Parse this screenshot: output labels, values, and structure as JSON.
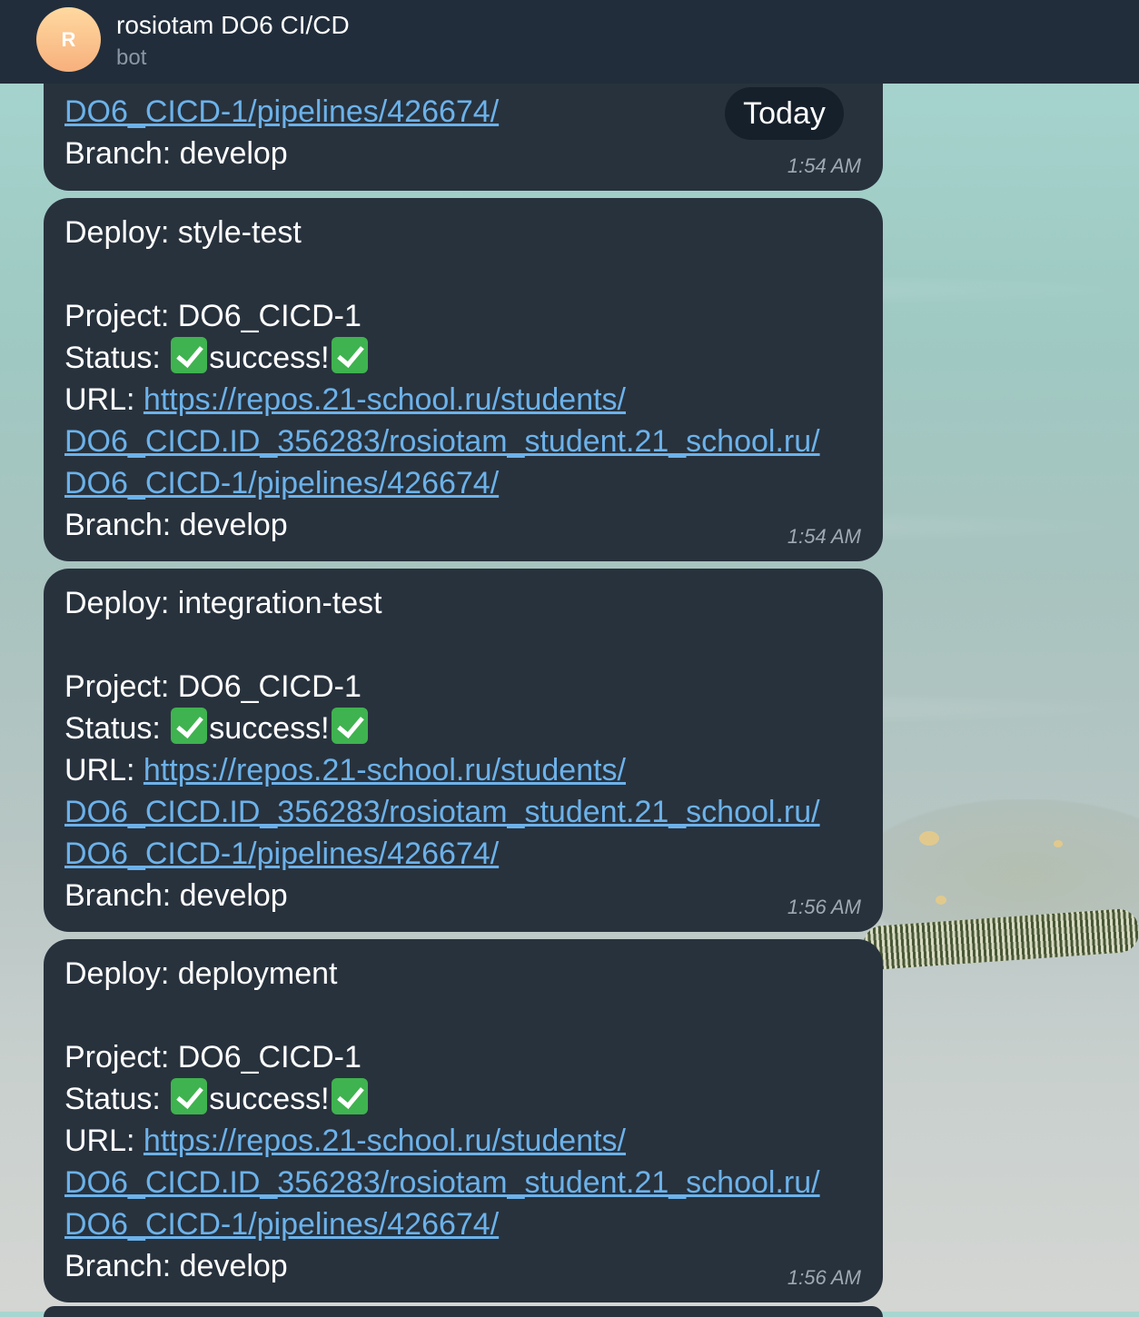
{
  "header": {
    "avatar_letter": "R",
    "title": "rosiotam DO6 CI/CD",
    "subtitle": "bot"
  },
  "date_badge": "Today",
  "messages": [
    {
      "partial": true,
      "url_line3": "DO6_CICD-1/pipelines/426674/",
      "branch": "Branch: develop",
      "time": "1:54 AM"
    },
    {
      "deploy": "Deploy: style-test",
      "project": "Project: DO6_CICD-1",
      "status_prefix": "Status: ",
      "status_text": "success!",
      "url_prefix": "URL: ",
      "url_line1": "https://repos.21-school.ru/students/",
      "url_line2": "DO6_CICD.ID_356283/rosiotam_student.21_school.ru/",
      "url_line3": "DO6_CICD-1/pipelines/426674/",
      "branch": "Branch: develop",
      "time": "1:54 AM"
    },
    {
      "deploy": "Deploy: integration-test",
      "project": "Project: DO6_CICD-1",
      "status_prefix": "Status: ",
      "status_text": "success!",
      "url_prefix": "URL: ",
      "url_line1": "https://repos.21-school.ru/students/",
      "url_line2": "DO6_CICD.ID_356283/rosiotam_student.21_school.ru/",
      "url_line3": "DO6_CICD-1/pipelines/426674/",
      "branch": "Branch: develop",
      "time": "1:56 AM"
    },
    {
      "deploy": "Deploy: deployment",
      "project": "Project: DO6_CICD-1",
      "status_prefix": "Status: ",
      "status_text": "success!",
      "url_prefix": "URL: ",
      "url_line1": "https://repos.21-school.ru/students/",
      "url_line2": "DO6_CICD.ID_356283/rosiotam_student.21_school.ru/",
      "url_line3": "DO6_CICD-1/pipelines/426674/",
      "branch": "Branch: develop",
      "time": "1:56 AM"
    }
  ],
  "colors": {
    "header_bg": "#212d3b",
    "bubble_bg": "#28323d",
    "link": "#6cb2ea",
    "check_green": "#3fb34f"
  }
}
